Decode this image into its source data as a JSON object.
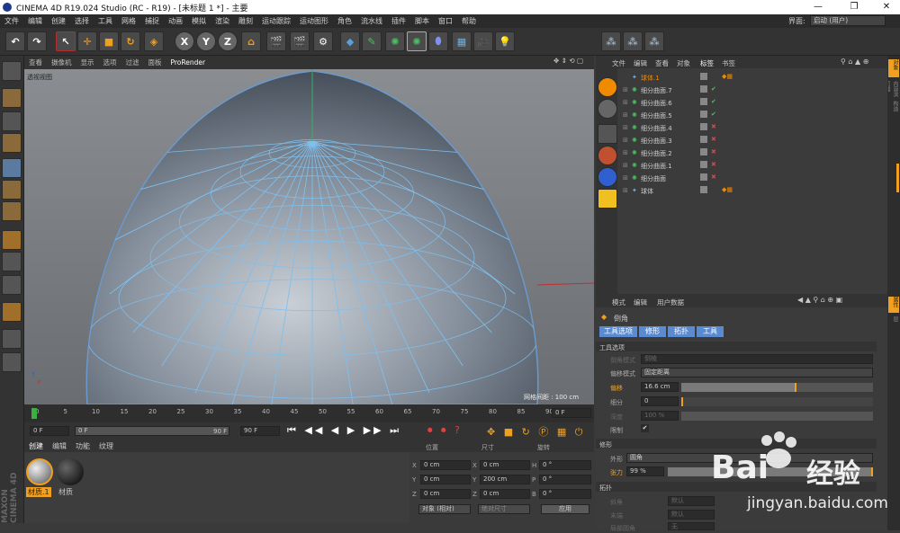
{
  "window": {
    "title": "CINEMA 4D R19.024 Studio (RC - R19) - [未标题 1 *] - 主要",
    "minimize": "—",
    "maximize": "❐",
    "close": "✕"
  },
  "menu": [
    "文件",
    "编辑",
    "创建",
    "选择",
    "工具",
    "网格",
    "捕捉",
    "动画",
    "模拟",
    "渲染",
    "雕刻",
    "运动跟踪",
    "运动图形",
    "角色",
    "流水线",
    "插件",
    "脚本",
    "窗口",
    "帮助"
  ],
  "layout": {
    "label": "界面:",
    "value": "启动 (用户)"
  },
  "toolbar": {
    "axis_x": "X",
    "axis_y": "Y",
    "axis_z": "Z"
  },
  "viewport": {
    "menu": [
      "查看",
      "摄像机",
      "显示",
      "选项",
      "过滤",
      "面板",
      "ProRender"
    ],
    "view_name": "透视视图",
    "grid_info": "网格间距 : 100 cm"
  },
  "timeline": {
    "ticks": [
      "0",
      "5",
      "10",
      "15",
      "20",
      "25",
      "30",
      "35",
      "40",
      "45",
      "50",
      "55",
      "60",
      "65",
      "70",
      "75",
      "80",
      "85",
      "90"
    ],
    "current_frame": "0 F"
  },
  "playbar": {
    "start": "0 F",
    "cur": "0 F",
    "end_slider": "90 F",
    "end": "90 F"
  },
  "materials": {
    "menu": [
      "创建",
      "编辑",
      "功能",
      "纹理"
    ],
    "items": [
      "材质.1",
      "材质"
    ]
  },
  "coords": {
    "headers": [
      "位置",
      "尺寸",
      "旋转"
    ],
    "rows": [
      {
        "axis": "X",
        "pos": "0 cm",
        "size_axis": "X",
        "size": "0 cm",
        "rot_axis": "H",
        "rot": "0 °"
      },
      {
        "axis": "Y",
        "pos": "0 cm",
        "size_axis": "Y",
        "size": "200 cm",
        "rot_axis": "P",
        "rot": "0 °"
      },
      {
        "axis": "Z",
        "pos": "0 cm",
        "size_axis": "Z",
        "size": "0 cm",
        "rot_axis": "B",
        "rot": "0 °"
      }
    ],
    "mode": "对象 (相对)",
    "size_mode": "绝对尺寸",
    "apply": "应用"
  },
  "objects": {
    "menu": [
      "文件",
      "编辑",
      "查看",
      "对象",
      "标签",
      "书签"
    ],
    "items": [
      "球体.1",
      "细分曲面.7",
      "细分曲面.6",
      "细分曲面.5",
      "细分曲面.4",
      "细分曲面.3",
      "细分曲面.2",
      "细分曲面.1",
      "细分曲面",
      "球体"
    ]
  },
  "attributes": {
    "menu": [
      "模式",
      "编辑",
      "用户数据"
    ],
    "tool_name": "倒角",
    "tabs": [
      "工具选项",
      "修形",
      "拓扑",
      "工具"
    ],
    "section_tool": "工具选项",
    "bevel_mode_label": "倒角模式",
    "bevel_mode": "倒棱",
    "offset_mode_label": "偏移模式",
    "offset_mode": "固定距离",
    "offset_label": "偏移",
    "offset": "16.6 cm",
    "offset_pct": 60,
    "subdiv_label": "细分",
    "subdiv": "0",
    "depth_label": "深度",
    "depth": "100 %",
    "limit_label": "限制",
    "section_shape": "修形",
    "shape_label": "外形",
    "shape": "圆角",
    "tension_label": "张力",
    "tension": "99 %",
    "section_topo": "拓扑",
    "miter_label": "斜角",
    "miter": "默认",
    "end_label": "末端",
    "end": "默认",
    "poly_label": "局部圆角",
    "poly": "无"
  },
  "right_tabs": [
    "对象",
    "内容浏览器",
    "构造",
    "属性",
    "层"
  ],
  "watermark": {
    "logo_text": "Bai",
    "logo_text2": "经验",
    "url": "jingyan.baidu.com"
  },
  "colors": {
    "accent": "#f08a00",
    "selected": "#5a8ad0",
    "wire": "#7ec0f0"
  }
}
